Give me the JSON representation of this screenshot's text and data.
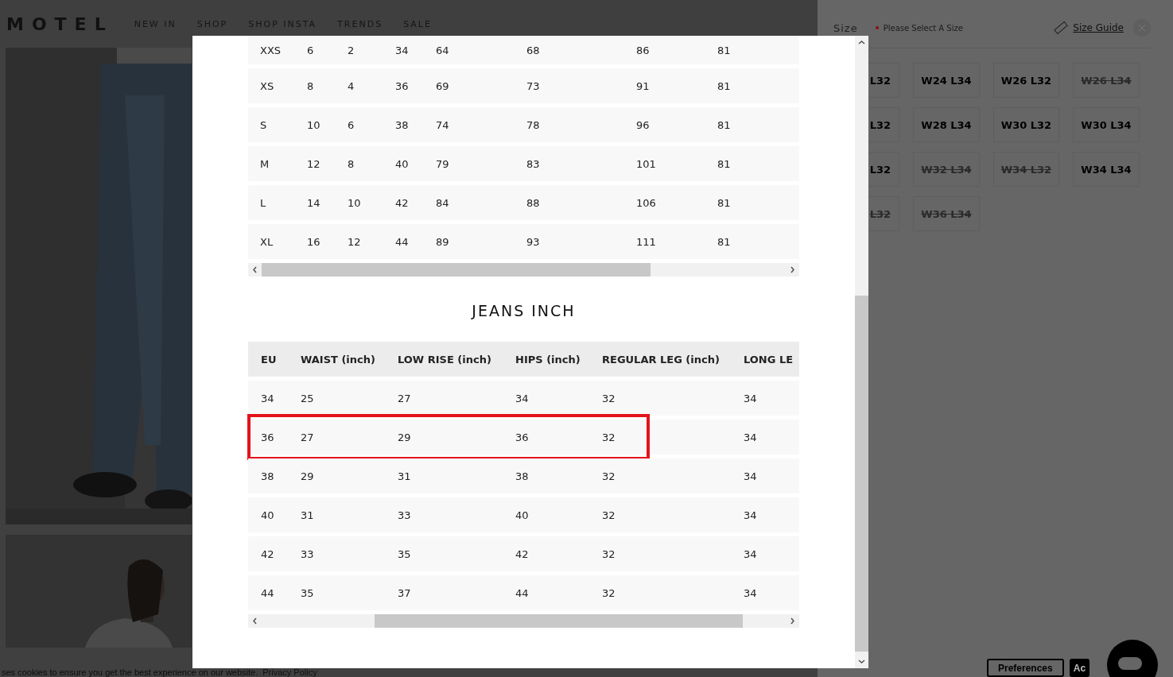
{
  "header": {
    "logo": "MOTEL",
    "nav": [
      "NEW IN",
      "SHOP",
      "SHOP INSTA",
      "TRENDS",
      "SALE"
    ]
  },
  "size_panel": {
    "label": "Size",
    "notice": "Please Select A Size",
    "guide_link": "Size Guide",
    "options": [
      {
        "label": "L32",
        "available": true,
        "clipped": true
      },
      {
        "label": "W24 L34",
        "available": true,
        "clipped": false
      },
      {
        "label": "W26 L32",
        "available": true,
        "clipped": false
      },
      {
        "label": "W26 L34",
        "available": false,
        "clipped": false
      },
      {
        "label": "L32",
        "available": true,
        "clipped": true
      },
      {
        "label": "W28 L34",
        "available": true,
        "clipped": false
      },
      {
        "label": "W30 L32",
        "available": true,
        "clipped": false
      },
      {
        "label": "W30 L34",
        "available": true,
        "clipped": false
      },
      {
        "label": "L32",
        "available": true,
        "clipped": true
      },
      {
        "label": "W32 L34",
        "available": false,
        "clipped": false
      },
      {
        "label": "W34 L32",
        "available": false,
        "clipped": false
      },
      {
        "label": "W34 L34",
        "available": true,
        "clipped": false
      },
      {
        "label": "L32",
        "available": false,
        "clipped": true
      },
      {
        "label": "W36 L34",
        "available": false,
        "clipped": false
      }
    ]
  },
  "modal": {
    "cm_table": {
      "rows": [
        [
          "XXS",
          "6",
          "2",
          "34",
          "64",
          "68",
          "86",
          "81"
        ],
        [
          "XS",
          "8",
          "4",
          "36",
          "69",
          "73",
          "91",
          "81"
        ],
        [
          "S",
          "10",
          "6",
          "38",
          "74",
          "78",
          "96",
          "81"
        ],
        [
          "M",
          "12",
          "8",
          "40",
          "79",
          "83",
          "101",
          "81"
        ],
        [
          "L",
          "14",
          "10",
          "42",
          "84",
          "88",
          "106",
          "81"
        ],
        [
          "XL",
          "16",
          "12",
          "44",
          "89",
          "93",
          "111",
          "81"
        ]
      ]
    },
    "inch_table": {
      "title": "JEANS INCH",
      "columns": [
        "EU",
        "WAIST (inch)",
        "LOW RISE (inch)",
        "HIPS (inch)",
        "REGULAR LEG (inch)",
        "LONG LE"
      ],
      "rows": [
        {
          "cells": [
            "34",
            "25",
            "27",
            "34",
            "32",
            "34"
          ],
          "highlighted": false
        },
        {
          "cells": [
            "36",
            "27",
            "29",
            "36",
            "32",
            "34"
          ],
          "highlighted": true
        },
        {
          "cells": [
            "38",
            "29",
            "31",
            "38",
            "32",
            "34"
          ],
          "highlighted": false
        },
        {
          "cells": [
            "40",
            "31",
            "33",
            "40",
            "32",
            "34"
          ],
          "highlighted": false
        },
        {
          "cells": [
            "42",
            "33",
            "35",
            "42",
            "32",
            "34"
          ],
          "highlighted": false
        },
        {
          "cells": [
            "44",
            "35",
            "37",
            "44",
            "32",
            "34"
          ],
          "highlighted": false
        }
      ]
    }
  },
  "cookie_bar": {
    "text": "ses cookies to ensure you get the best experience on our website.",
    "link": "Privacy Policy",
    "buttons": [
      "Preferences",
      "Ac"
    ]
  }
}
